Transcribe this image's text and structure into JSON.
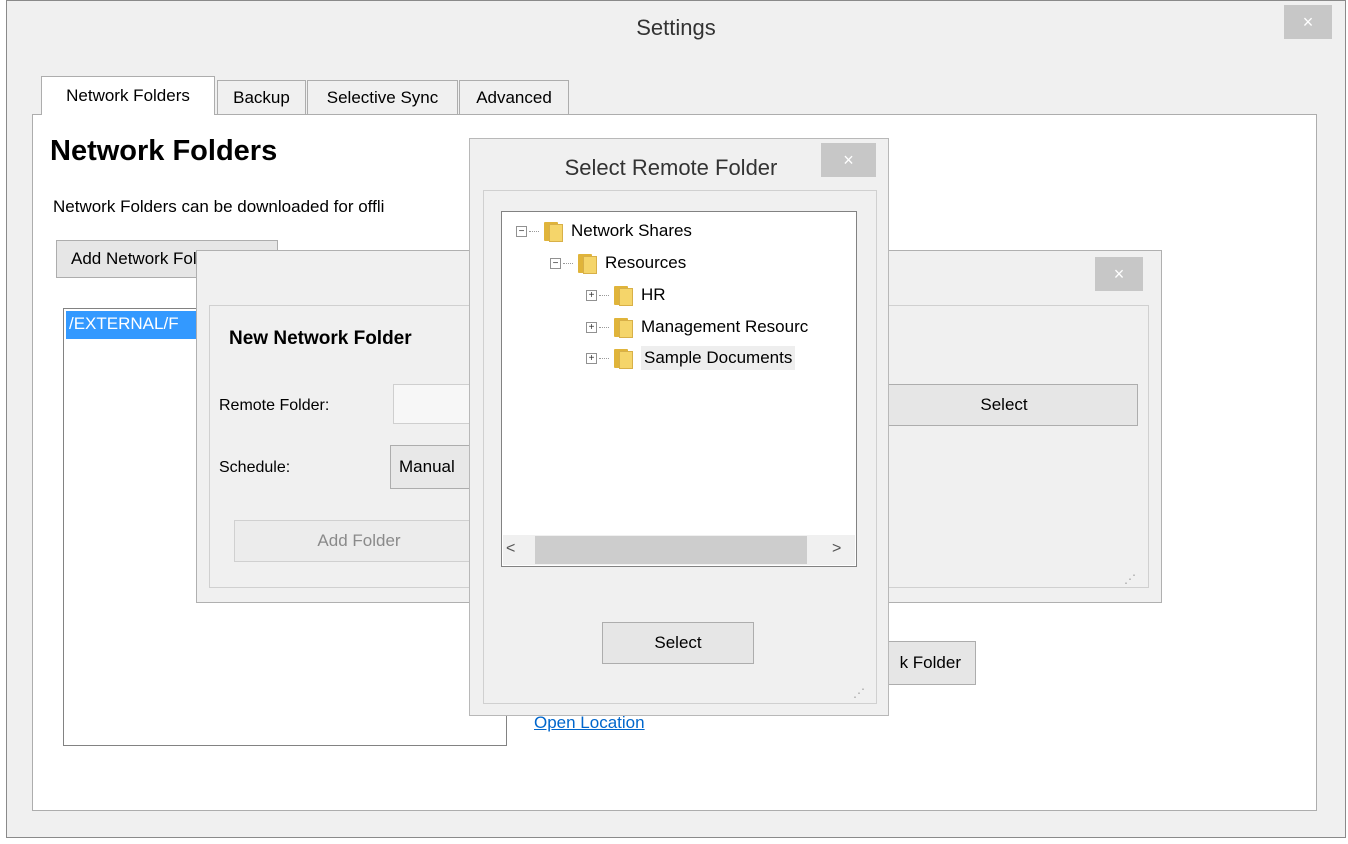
{
  "settings": {
    "title": "Settings",
    "close_icon": "×",
    "tabs": [
      {
        "label": "Network Folders",
        "active": true
      },
      {
        "label": "Backup",
        "active": false
      },
      {
        "label": "Selective Sync",
        "active": false
      },
      {
        "label": "Advanced",
        "active": false
      }
    ],
    "heading": "Network Folders",
    "description": "Network Folders can be downloaded for offli",
    "add_button": "Add Network Folder",
    "folder_list": [
      "/EXTERNAL/F"
    ],
    "open_location": "Open Location",
    "partial_button": "k Folder"
  },
  "new_network_folder": {
    "close_icon": "×",
    "title": "New Network Folder",
    "remote_folder_label": "Remote Folder:",
    "remote_folder_value": "",
    "schedule_label": "Schedule:",
    "schedule_value": "Manual",
    "add_folder_button": "Add Folder",
    "select_button": "Select"
  },
  "select_remote_folder": {
    "title": "Select Remote Folder",
    "close_icon": "×",
    "tree": {
      "root": "Network Shares",
      "child": "Resources",
      "items": [
        "HR",
        "Management Resourc",
        "Sample Documents"
      ]
    },
    "scroll_left": "<",
    "scroll_right": ">",
    "select_button": "Select"
  },
  "icons": {
    "close": "close-icon",
    "folder": "folder-icon",
    "expand": "plus-expander-icon",
    "collapse": "minus-expander-icon"
  },
  "colors": {
    "selection": "#3399ff",
    "link": "#0066cc",
    "close_button": "#c7c7c7"
  }
}
